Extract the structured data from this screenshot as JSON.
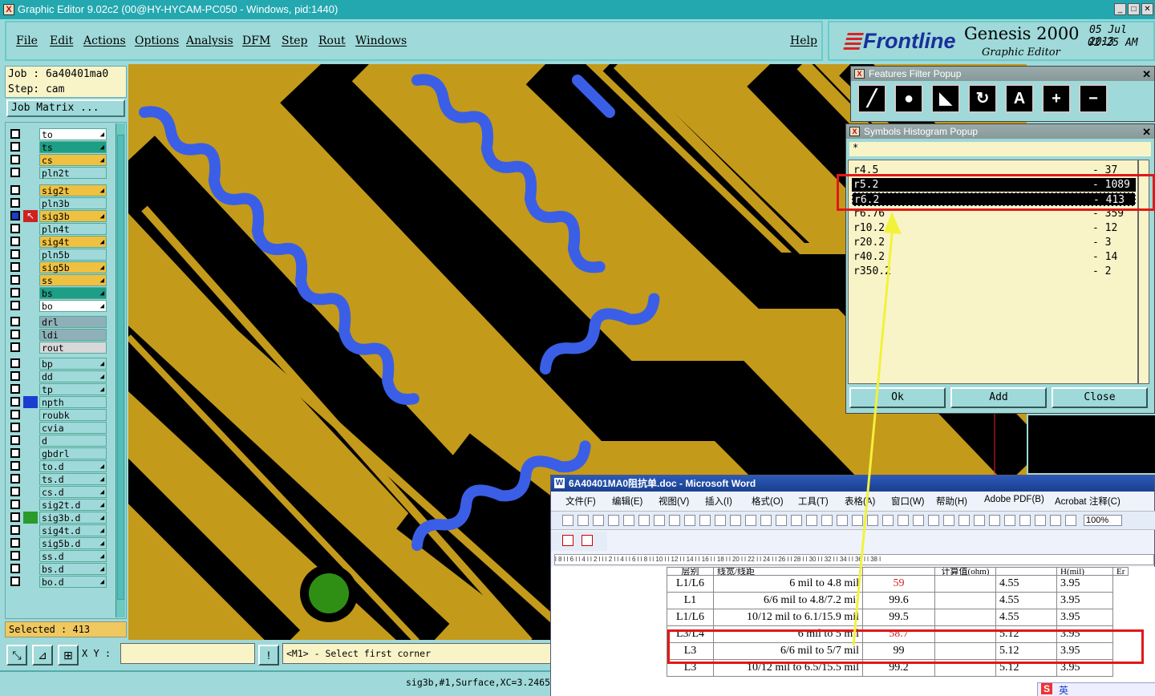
{
  "window": {
    "title": "Graphic Editor 9.02c2 (00@HY-HYCAM-PC050 - Windows, pid:1440)"
  },
  "menu": [
    "File",
    "Edit",
    "Actions",
    "Options",
    "Analysis",
    "DFM",
    "Step",
    "Rout",
    "Windows"
  ],
  "help_label": "Help",
  "brand": {
    "logo": "Frontline",
    "product": "Genesis 2000",
    "subtitle": "Graphic Editor",
    "date": "05 Jul 2013",
    "time": "02:25 AM"
  },
  "job": {
    "job_line": "Job : 6a40401ma0",
    "step_line": "Step: cam",
    "matrix_button": "Job Matrix ..."
  },
  "layers": [
    {
      "name": "to",
      "color": "#ffffff",
      "arrow": true
    },
    {
      "name": "ts",
      "color": "#1f9e86",
      "arrow": true
    },
    {
      "name": "cs",
      "color": "#f0c040",
      "arrow": true
    },
    {
      "name": "pln2t",
      "color": "#9fd9d9",
      "arrow": false
    },
    {
      "name": "sig2t",
      "color": "#f0c040",
      "arrow": true
    },
    {
      "name": "pln3b",
      "color": "#9fd9d9",
      "arrow": false
    },
    {
      "name": "sig3b",
      "color": "#f0c040",
      "arrow": true,
      "active": true
    },
    {
      "name": "pln4t",
      "color": "#9fd9d9",
      "arrow": false
    },
    {
      "name": "sig4t",
      "color": "#f0c040",
      "arrow": true
    },
    {
      "name": "pln5b",
      "color": "#9fd9d9",
      "arrow": false
    },
    {
      "name": "sig5b",
      "color": "#f0c040",
      "arrow": true
    },
    {
      "name": "ss",
      "color": "#f0c040",
      "arrow": true
    },
    {
      "name": "bs",
      "color": "#1f9e86",
      "arrow": true
    },
    {
      "name": "bo",
      "color": "#ffffff",
      "arrow": true
    },
    {
      "name": "drl",
      "color": "#8fb0b8",
      "arrow": false
    },
    {
      "name": "ldi",
      "color": "#8fb0b8",
      "arrow": false
    },
    {
      "name": "rout",
      "color": "#d8d8d8",
      "arrow": false
    },
    {
      "name": "bp",
      "color": "#9fd9d9",
      "arrow": true
    },
    {
      "name": "dd",
      "color": "#9fd9d9",
      "arrow": true
    },
    {
      "name": "tp",
      "color": "#9fd9d9",
      "arrow": true
    },
    {
      "name": "npth",
      "color": "#9fd9d9",
      "arrow": false,
      "mark": "#1a3fd0"
    },
    {
      "name": "roubk",
      "color": "#9fd9d9",
      "arrow": false
    },
    {
      "name": "cvia",
      "color": "#9fd9d9",
      "arrow": false
    },
    {
      "name": "d",
      "color": "#9fd9d9",
      "arrow": false
    },
    {
      "name": "gbdrl",
      "color": "#9fd9d9",
      "arrow": false
    },
    {
      "name": "to.d",
      "color": "#9fd9d9",
      "arrow": true
    },
    {
      "name": "ts.d",
      "color": "#9fd9d9",
      "arrow": true
    },
    {
      "name": "cs.d",
      "color": "#9fd9d9",
      "arrow": true
    },
    {
      "name": "sig2t.d",
      "color": "#9fd9d9",
      "arrow": true
    },
    {
      "name": "sig3b.d",
      "color": "#9fd9d9",
      "arrow": true,
      "mark": "#2a9a2a"
    },
    {
      "name": "sig4t.d",
      "color": "#9fd9d9",
      "arrow": true
    },
    {
      "name": "sig5b.d",
      "color": "#9fd9d9",
      "arrow": true
    },
    {
      "name": "ss.d",
      "color": "#9fd9d9",
      "arrow": true
    },
    {
      "name": "bs.d",
      "color": "#9fd9d9",
      "arrow": true
    },
    {
      "name": "bo.d",
      "color": "#9fd9d9",
      "arrow": true
    }
  ],
  "selected": "Selected : 413",
  "xy_label": "X Y :",
  "prompt": "<M1> - Select first corner",
  "status": "sig3b,#1,Surface,XC=3.2465",
  "features_filter": {
    "title": "Features Filter Popup"
  },
  "histogram": {
    "title": "Symbols Histogram Popup",
    "filter": "*",
    "rows": [
      {
        "symbol": "r4.5",
        "count": "- 37"
      },
      {
        "symbol": "r5.2",
        "count": "- 1089"
      },
      {
        "symbol": "r6.2",
        "count": "- 413"
      },
      {
        "symbol": "r6.76",
        "count": "- 359"
      },
      {
        "symbol": "r10.2",
        "count": "- 12"
      },
      {
        "symbol": "r20.2",
        "count": "- 3"
      },
      {
        "symbol": "r40.2",
        "count": "- 14"
      },
      {
        "symbol": "r350.2",
        "count": "- 2"
      }
    ],
    "ok": "Ok",
    "add": "Add",
    "close": "Close"
  },
  "word": {
    "title": "6A40401MA0阻抗单.doc - Microsoft Word",
    "menu": [
      "文件(F)",
      "编辑(E)",
      "视图(V)",
      "插入(I)",
      "格式(O)",
      "工具(T)",
      "表格(A)",
      "窗口(W)",
      "帮助(H)",
      "Adobe PDF(B)",
      "Acrobat 注释(C)"
    ],
    "zoom": "100%",
    "ruler": "l 8 l   l 6 l   l 4 l   l 2 l   l   l 2 l   l 4 l   l 6 l   l 8 l  l 10 l  l 12 l  l 14 l  l 16 l  l 18 l  l 20 l  l 22 l  l 24 l  l 26 l  l 28 l  l 30 l  l 32 l  l 34 l  l 36 l  l 38 l",
    "header_row": [
      "层别",
      "线宽/线距",
      "",
      "计算值(ohm)",
      "",
      "H(mil)",
      "Er"
    ],
    "rows": [
      {
        "layer": "L1/L6",
        "width": "6 mil to 4.8 mil",
        "calc": "59",
        "red": true,
        "h": "4.55",
        "er": "3.95"
      },
      {
        "layer": "L1",
        "width": "6/6 mil to 4.8/7.2 mil",
        "calc": "99.6",
        "red": false,
        "h": "4.55",
        "er": "3.95"
      },
      {
        "layer": "L1/L6",
        "width": "10/12 mil to 6.1/15.9 mil",
        "calc": "99.5",
        "red": false,
        "h": "4.55",
        "er": "3.95"
      },
      {
        "layer": "L3/L4",
        "width": "6 mil to 5 mil",
        "calc": "58.7",
        "red": true,
        "h": "5.12",
        "er": "3.95"
      },
      {
        "layer": "L3",
        "width": "6/6 mil to 5/7 mil",
        "calc": "99",
        "red": false,
        "h": "5.12",
        "er": "3.95"
      },
      {
        "layer": "L3",
        "width": "10/12 mil to 6.5/15.5 mil",
        "calc": "99.2",
        "red": false,
        "h": "5.12",
        "er": "3.95"
      }
    ],
    "ime": "英"
  }
}
